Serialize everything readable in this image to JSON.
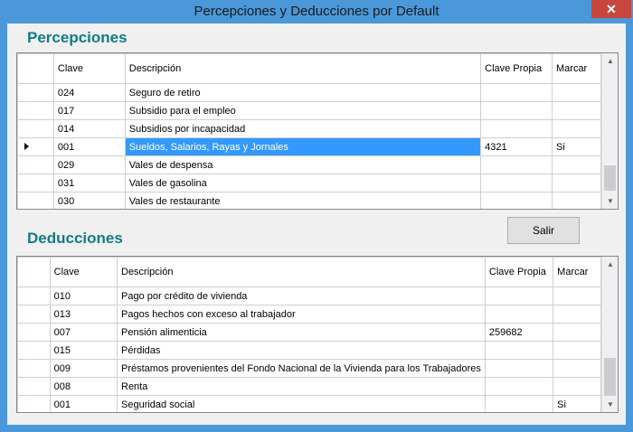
{
  "window": {
    "title": "Percepciones y Deducciones por Default",
    "close_glyph": "✕"
  },
  "columns": {
    "clave": "Clave",
    "descripcion": "Descripción",
    "clave_propia": "Clave Propia",
    "marcar": "Marcar"
  },
  "percepciones": {
    "title": "Percepciones",
    "rows": [
      {
        "clave": "024",
        "descripcion": "Seguro de retiro",
        "clave_propia": "",
        "marcar": "",
        "selected": false
      },
      {
        "clave": "017",
        "descripcion": "Subsidio para el empleo",
        "clave_propia": "",
        "marcar": "",
        "selected": false
      },
      {
        "clave": "014",
        "descripcion": "Subsidios por incapacidad",
        "clave_propia": "",
        "marcar": "",
        "selected": false
      },
      {
        "clave": "001",
        "descripcion": "Sueldos, Salarios, Rayas y Jornales",
        "clave_propia": "4321",
        "marcar": "Si",
        "selected": true
      },
      {
        "clave": "029",
        "descripcion": "Vales de despensa",
        "clave_propia": "",
        "marcar": "",
        "selected": false
      },
      {
        "clave": "031",
        "descripcion": "Vales de gasolina",
        "clave_propia": "",
        "marcar": "",
        "selected": false
      },
      {
        "clave": "030",
        "descripcion": "Vales de restaurante",
        "clave_propia": "",
        "marcar": "",
        "selected": false
      }
    ]
  },
  "deducciones": {
    "title": "Deducciones",
    "rows": [
      {
        "clave": "010",
        "descripcion": "Pago por crédito de vivienda",
        "clave_propia": "",
        "marcar": ""
      },
      {
        "clave": "013",
        "descripcion": "Pagos hechos con exceso al trabajador",
        "clave_propia": "",
        "marcar": ""
      },
      {
        "clave": "007",
        "descripcion": "Pensión alimenticia",
        "clave_propia": "259682",
        "marcar": ""
      },
      {
        "clave": "015",
        "descripcion": "Pérdidas",
        "clave_propia": "",
        "marcar": ""
      },
      {
        "clave": "009",
        "descripcion": "Préstamos provenientes del Fondo Nacional de la Vivienda para los Trabajadores",
        "clave_propia": "",
        "marcar": ""
      },
      {
        "clave": "008",
        "descripcion": "Renta",
        "clave_propia": "",
        "marcar": ""
      },
      {
        "clave": "001",
        "descripcion": "Seguridad social",
        "clave_propia": "",
        "marcar": "Si"
      }
    ]
  },
  "buttons": {
    "salir": "Salir"
  },
  "icons": {
    "current_row": "row-indicator-arrow-icon",
    "scroll_up": "chevron-up-icon",
    "scroll_down": "chevron-down-icon"
  }
}
